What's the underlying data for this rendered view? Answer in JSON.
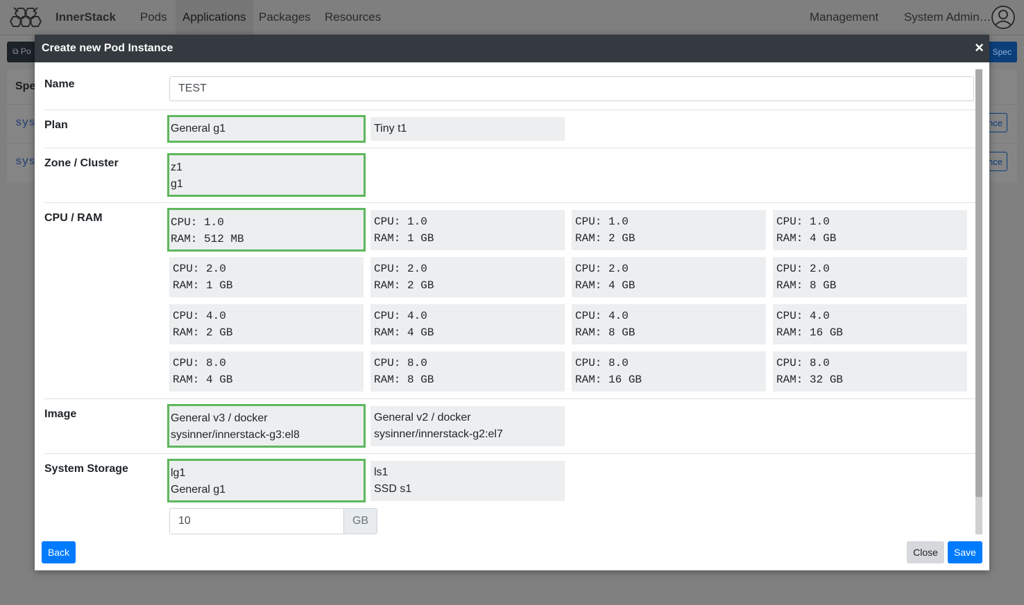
{
  "navbar": {
    "brand": "InnerStack",
    "links": [
      "Pods",
      "Applications",
      "Packages",
      "Resources"
    ],
    "active_link": "Applications",
    "management": "Management",
    "user": "System Admin…"
  },
  "background": {
    "toolbar_left": "Po",
    "toolbar_right": "Spec",
    "card_header": "Spe",
    "rows": [
      "sys",
      "sys"
    ],
    "row_button": "nce"
  },
  "modal": {
    "title": "Create new Pod Instance",
    "close_symbol": "×",
    "name": {
      "label": "Name",
      "value": "TEST"
    },
    "plan": {
      "label": "Plan",
      "options": [
        "General g1",
        "Tiny t1"
      ],
      "selected": 0
    },
    "zone": {
      "label": "Zone / Cluster",
      "options": [
        {
          "line1": "z1",
          "line2": "g1"
        }
      ],
      "selected": 0
    },
    "cpu_ram": {
      "label": "CPU / RAM",
      "options": [
        {
          "cpu": "CPU: 1.0",
          "ram": "RAM: 512 MB"
        },
        {
          "cpu": "CPU: 1.0",
          "ram": "RAM: 1 GB"
        },
        {
          "cpu": "CPU: 1.0",
          "ram": "RAM: 2 GB"
        },
        {
          "cpu": "CPU: 1.0",
          "ram": "RAM: 4 GB"
        },
        {
          "cpu": "CPU: 2.0",
          "ram": "RAM: 1 GB"
        },
        {
          "cpu": "CPU: 2.0",
          "ram": "RAM: 2 GB"
        },
        {
          "cpu": "CPU: 2.0",
          "ram": "RAM: 4 GB"
        },
        {
          "cpu": "CPU: 2.0",
          "ram": "RAM: 8 GB"
        },
        {
          "cpu": "CPU: 4.0",
          "ram": "RAM: 2 GB"
        },
        {
          "cpu": "CPU: 4.0",
          "ram": "RAM: 4 GB"
        },
        {
          "cpu": "CPU: 4.0",
          "ram": "RAM: 8 GB"
        },
        {
          "cpu": "CPU: 4.0",
          "ram": "RAM: 16 GB"
        },
        {
          "cpu": "CPU: 8.0",
          "ram": "RAM: 4 GB"
        },
        {
          "cpu": "CPU: 8.0",
          "ram": "RAM: 8 GB"
        },
        {
          "cpu": "CPU: 8.0",
          "ram": "RAM: 16 GB"
        },
        {
          "cpu": "CPU: 8.0",
          "ram": "RAM: 32 GB"
        }
      ],
      "selected": 0
    },
    "image": {
      "label": "Image",
      "options": [
        {
          "line1": "General v3 / docker",
          "line2": "sysinner/innerstack-g3:el8"
        },
        {
          "line1": "General v2 / docker",
          "line2": "sysinner/innerstack-g2:el7"
        }
      ],
      "selected": 0
    },
    "storage": {
      "label": "System Storage",
      "options": [
        {
          "line1": "lg1",
          "line2": "General g1"
        },
        {
          "line1": "ls1",
          "line2": "SSD s1"
        }
      ],
      "selected": 0,
      "size_value": "10",
      "size_unit": "GB"
    },
    "buttons": {
      "back": "Back",
      "close": "Close",
      "save": "Save"
    },
    "accent_color": "#5cb85c",
    "primary_color": "#007bff"
  }
}
